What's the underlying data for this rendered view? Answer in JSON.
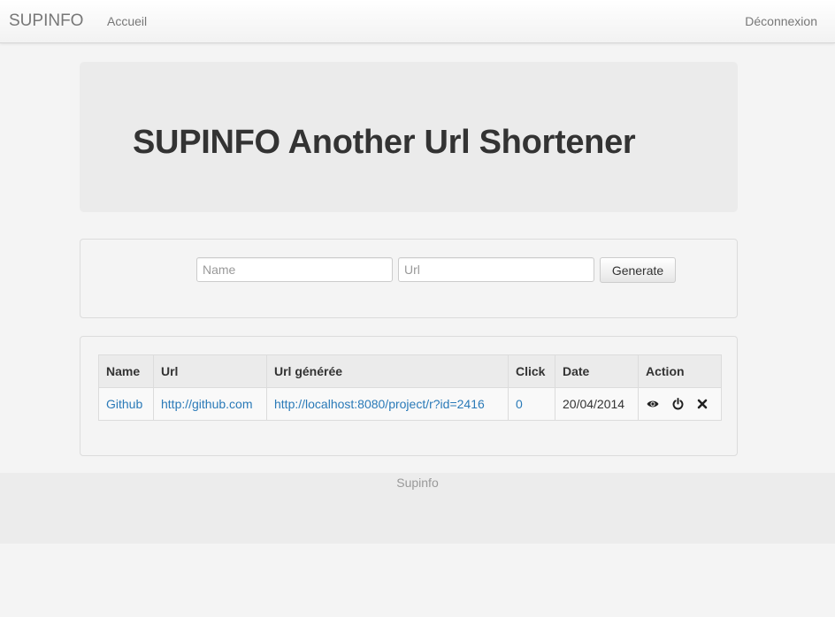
{
  "navbar": {
    "brand": "SUPINFO",
    "home_link": "Accueil",
    "logout_link": "Déconnexion"
  },
  "hero": {
    "title": "SUPINFO Another Url Shortener"
  },
  "form": {
    "name_placeholder": "Name",
    "url_placeholder": "Url",
    "generate_label": "Generate"
  },
  "table": {
    "headers": [
      "Name",
      "Url",
      "Url générée",
      "Click",
      "Date",
      "Action"
    ],
    "rows": [
      {
        "name": "Github",
        "url": "http://github.com",
        "generated_url": "http://localhost:8080/project/r?id=2416",
        "clicks": "0",
        "date": "20/04/2014",
        "actions": [
          "eye-icon",
          "power-icon",
          "remove-icon"
        ]
      }
    ]
  },
  "footer": {
    "text": "Supinfo"
  },
  "colors": {
    "link": "#2a7ab8",
    "navbar_text": "#777777",
    "page_bg": "#f4f4f4"
  }
}
